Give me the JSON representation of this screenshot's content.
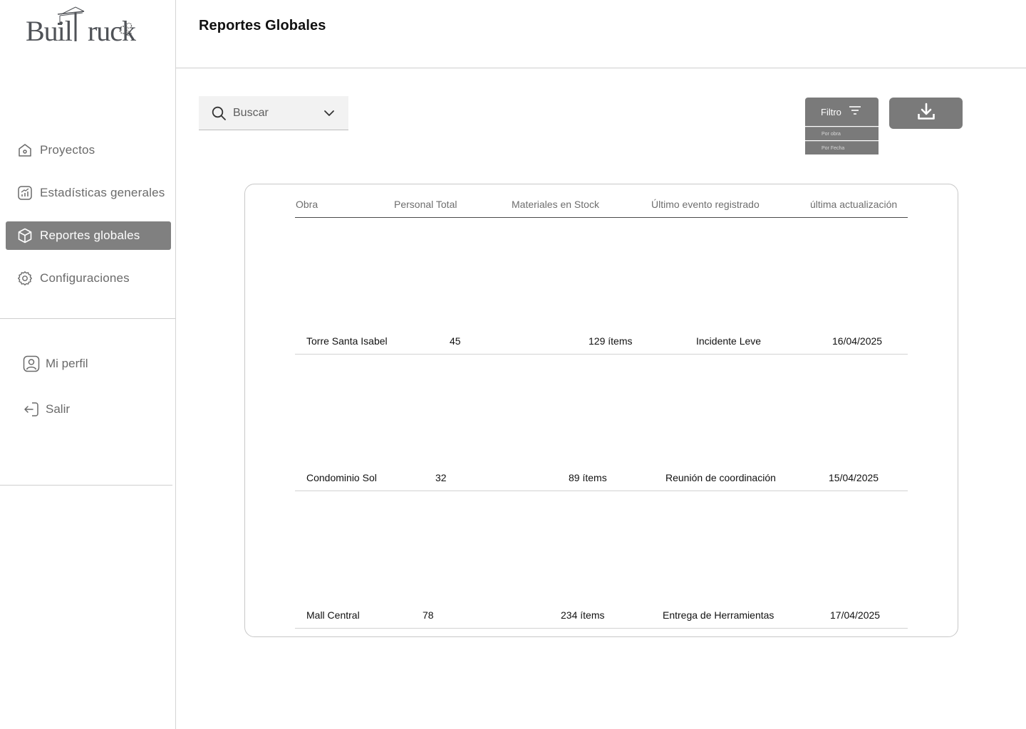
{
  "brand": {
    "name": "BuilTruck"
  },
  "sidebar": {
    "items": [
      {
        "label": "Proyectos",
        "icon": "home-icon"
      },
      {
        "label": "Estadísticas generales",
        "icon": "chart-icon"
      },
      {
        "label": "Reportes globales",
        "icon": "cube-icon",
        "active": true
      },
      {
        "label": "Configuraciones",
        "icon": "gear-icon"
      }
    ],
    "profile": {
      "label": "Mi perfil",
      "icon": "user-icon"
    },
    "logout": {
      "label": "Salir",
      "icon": "logout-icon"
    }
  },
  "header": {
    "title": "Reportes Globales"
  },
  "search": {
    "placeholder": "Buscar"
  },
  "filter": {
    "label": "Filtro",
    "options": [
      "Por obra",
      "Por Fecha"
    ]
  },
  "download": {
    "icon": "download-icon"
  },
  "table": {
    "columns": [
      "Obra",
      "Personal Total",
      "Materiales en Stock",
      "Último evento registrado",
      "última actualización"
    ],
    "rows": [
      [
        "Torre Santa Isabel",
        "45",
        "129 ítems",
        "Incidente Leve",
        "16/04/2025"
      ],
      [
        "Condominio Sol",
        "32",
        "89 ítems",
        "Reunión de coordinación",
        "15/04/2025"
      ],
      [
        "Mall Central",
        "78",
        "234 ítems",
        "Entrega de Herramientas",
        "17/04/2025"
      ]
    ]
  },
  "colors": {
    "accent": "#808080",
    "button": "#7a7a7a"
  }
}
